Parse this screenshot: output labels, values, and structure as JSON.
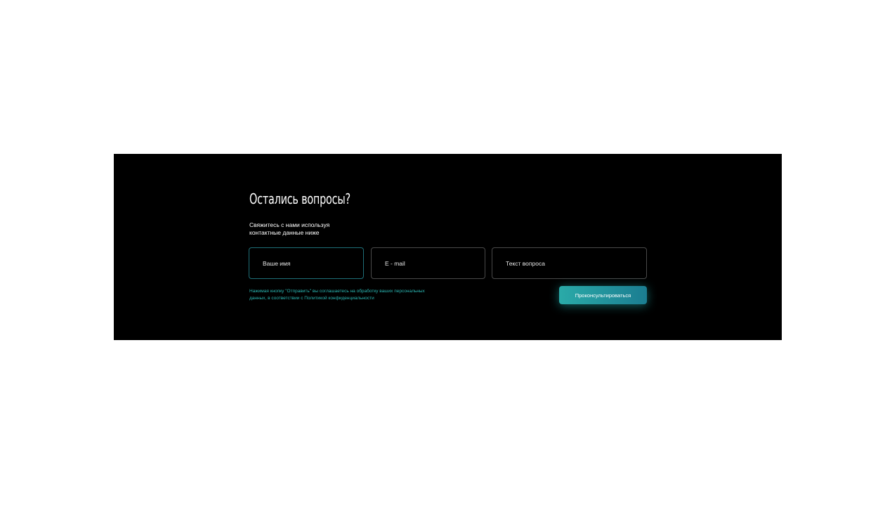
{
  "contact": {
    "title": "Остались вопросы?",
    "subtitle": "Свяжитесь с нами используя\nконтактные данные ниже",
    "fields": {
      "name_placeholder": "Ваше имя",
      "email_placeholder": "E - mail",
      "question_placeholder": "Текст вопроса"
    },
    "consent": "Нажимая кнопку \"Отправить\" вы соглашаетесь на обработку ваших персональных\nданных, в соответствии с Политикой конфиденциальности",
    "submit_label": "Проконсультироваться"
  },
  "colors": {
    "section_background": "#000000",
    "page_background": "#ffffff",
    "accent": "#2bb7b3",
    "button_gradient_start": "#2aaaa8",
    "button_gradient_end": "#1b7d91"
  }
}
